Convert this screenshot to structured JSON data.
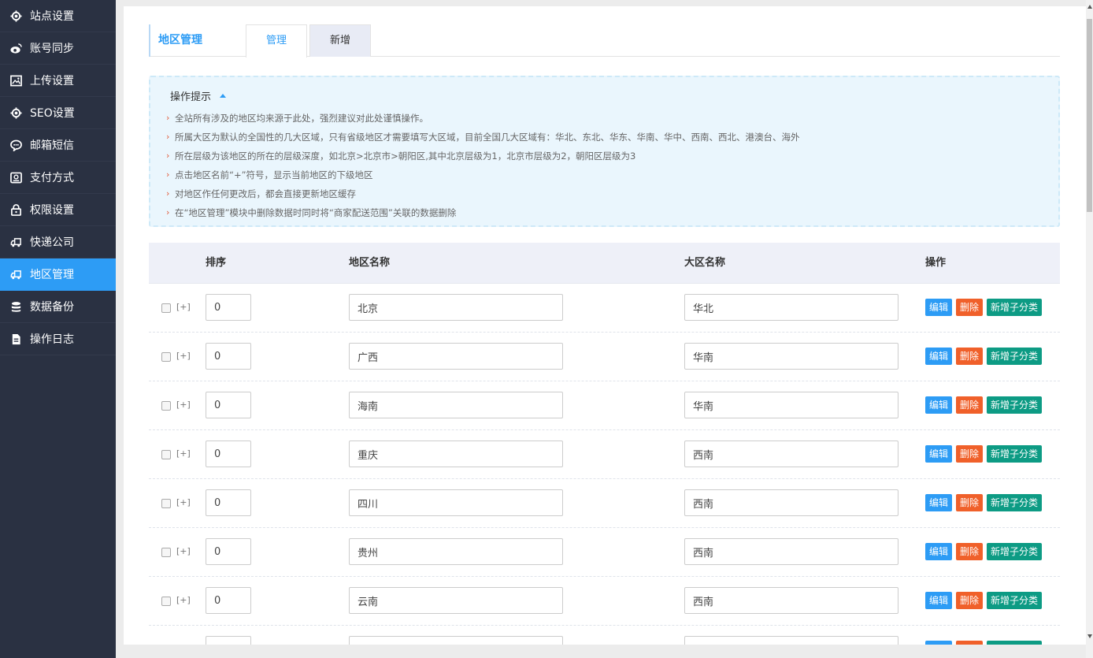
{
  "sidebar": {
    "items": [
      {
        "label": "站点设置",
        "icon": "gear-icon",
        "active": false
      },
      {
        "label": "账号同步",
        "icon": "weibo-icon",
        "active": false
      },
      {
        "label": "上传设置",
        "icon": "image-icon",
        "active": false
      },
      {
        "label": "SEO设置",
        "icon": "gear-icon",
        "active": false
      },
      {
        "label": "邮箱短信",
        "icon": "chat-bubble-icon",
        "active": false
      },
      {
        "label": "支付方式",
        "icon": "payment-icon",
        "active": false
      },
      {
        "label": "权限设置",
        "icon": "lock-icon",
        "active": false
      },
      {
        "label": "快递公司",
        "icon": "truck-icon",
        "active": false
      },
      {
        "label": "地区管理",
        "icon": "truck-icon",
        "active": true
      },
      {
        "label": "数据备份",
        "icon": "database-icon",
        "active": false
      },
      {
        "label": "操作日志",
        "icon": "log-icon",
        "active": false
      }
    ]
  },
  "header": {
    "title": "地区管理",
    "tabs": [
      {
        "label": "管理",
        "active": true
      },
      {
        "label": "新增",
        "active": false
      }
    ]
  },
  "tips": {
    "title": "操作提示",
    "items": [
      "全站所有涉及的地区均来源于此处，强烈建议对此处谨慎操作。",
      "所属大区为默认的全国性的几大区域，只有省级地区才需要填写大区域，目前全国几大区域有：华北、东北、华东、华南、华中、西南、西北、港澳台、海外",
      "所在层级为该地区的所在的层级深度，如北京>北京市>朝阳区,其中北京层级为1，北京市层级为2，朝阳区层级为3",
      "点击地区名前“+”符号，显示当前地区的下级地区",
      "对地区作任何更改后，都会直接更新地区缓存",
      "在“地区管理”模块中删除数据时同时将“商家配送范围”关联的数据删除"
    ]
  },
  "table": {
    "headers": {
      "sort": "排序",
      "name": "地区名称",
      "area": "大区名称",
      "ops": "操作"
    },
    "expand_label": "[+]",
    "buttons": {
      "edit": "编辑",
      "delete": "删除",
      "add_child": "新增子分类"
    },
    "rows": [
      {
        "sort": "0",
        "name": "北京",
        "area": "华北"
      },
      {
        "sort": "0",
        "name": "广西",
        "area": "华南"
      },
      {
        "sort": "0",
        "name": "海南",
        "area": "华南"
      },
      {
        "sort": "0",
        "name": "重庆",
        "area": "西南"
      },
      {
        "sort": "0",
        "name": "四川",
        "area": "西南"
      },
      {
        "sort": "0",
        "name": "贵州",
        "area": "西南"
      },
      {
        "sort": "0",
        "name": "云南",
        "area": "西南"
      }
    ]
  },
  "colors": {
    "sidebar_bg": "#2a3142",
    "accent": "#2d9cf5",
    "edit_button": "#2d9cf5",
    "delete_button": "#f0602a",
    "add_child_button": "#0d9b84"
  }
}
